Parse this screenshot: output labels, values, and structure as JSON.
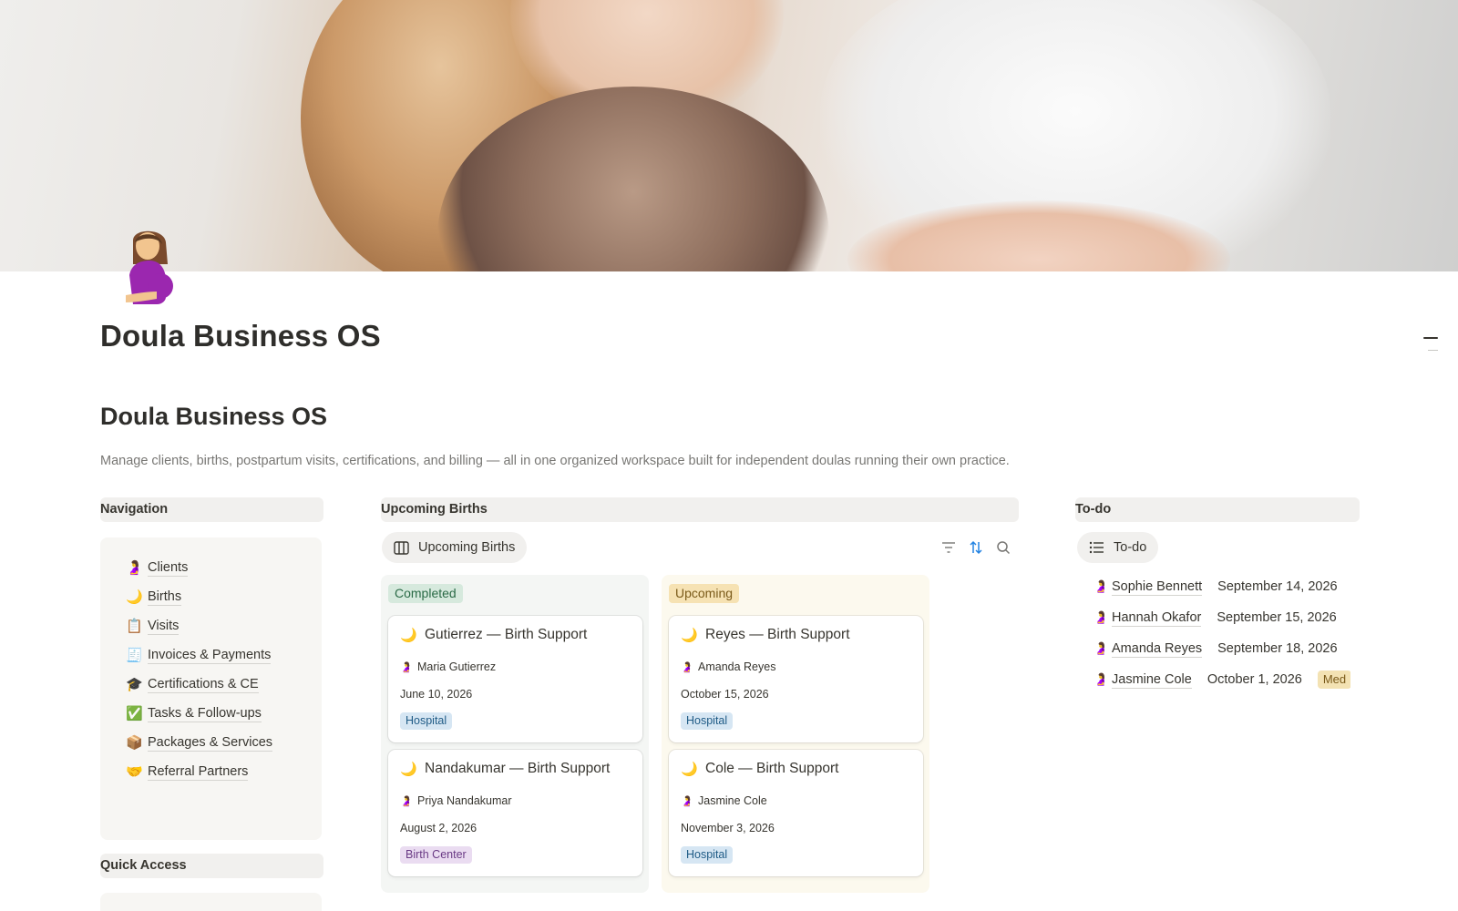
{
  "page": {
    "icon": "pregnant-woman-icon",
    "title": "Doula Business OS",
    "section_title": "Doula Business OS",
    "description": "Manage clients, births, postpartum visits, certifications, and billing — all in one organized workspace built for independent doulas running their own practice."
  },
  "navigation": {
    "header": "Navigation",
    "items": [
      {
        "emoji": "🤰",
        "icon": "pregnant-woman-icon",
        "label": "Clients"
      },
      {
        "emoji": "🌙",
        "icon": "crescent-moon-icon",
        "label": "Births"
      },
      {
        "emoji": "📋",
        "icon": "clipboard-icon",
        "label": "Visits"
      },
      {
        "emoji": "🧾",
        "icon": "receipt-icon",
        "label": "Invoices & Payments"
      },
      {
        "emoji": "🎓",
        "icon": "graduation-cap-icon",
        "label": "Certifications & CE"
      },
      {
        "emoji": "✅",
        "icon": "check-mark-icon",
        "label": "Tasks & Follow-ups"
      },
      {
        "emoji": "📦",
        "icon": "package-icon",
        "label": "Packages & Services"
      },
      {
        "emoji": "🤝",
        "icon": "handshake-icon",
        "label": "Referral Partners"
      }
    ]
  },
  "quick_access": {
    "header": "Quick Access"
  },
  "upcoming_births": {
    "header": "Upcoming Births",
    "view_tab": "Upcoming Births",
    "toolbar": [
      "filter-icon",
      "sort-icon",
      "search-icon"
    ],
    "columns": [
      {
        "status": "Completed",
        "cards": [
          {
            "emoji": "🌙",
            "title": "Gutierrez — Birth Support",
            "client": "Maria Gutierrez",
            "date": "June 10, 2026",
            "tag": "Hospital",
            "tag_color": "#d6e6f3"
          },
          {
            "emoji": "🌙",
            "title": "Nandakumar — Birth Support",
            "client": "Priya Nandakumar",
            "date": "August 2, 2026",
            "tag": "Birth Center",
            "tag_color": "#eadcf1"
          }
        ]
      },
      {
        "status": "Upcoming",
        "cards": [
          {
            "emoji": "🌙",
            "title": "Reyes — Birth Support",
            "client": "Amanda Reyes",
            "date": "October 15, 2026",
            "tag": "Hospital",
            "tag_color": "#d6e6f3"
          },
          {
            "emoji": "🌙",
            "title": "Cole — Birth Support",
            "client": "Jasmine Cole",
            "date": "November 3, 2026",
            "tag": "Hospital",
            "tag_color": "#d6e6f3"
          }
        ]
      }
    ]
  },
  "todo": {
    "header": "To-do",
    "view_tab": "To-do",
    "rows": [
      {
        "emoji": "🤰",
        "name": "Sophie Bennett",
        "date": "September 14, 2026",
        "tag": ""
      },
      {
        "emoji": "🤰",
        "name": "Hannah Okafor",
        "date": "September 15, 2026",
        "tag": ""
      },
      {
        "emoji": "🤰",
        "name": "Amanda Reyes",
        "date": "September 18, 2026",
        "tag": ""
      },
      {
        "emoji": "🤰",
        "name": "Jasmine Cole",
        "date": "October 1, 2026",
        "tag": "Med"
      }
    ]
  },
  "colors": {
    "text": "#37352f",
    "muted": "#787774",
    "completed_bg": "#d6e9dd",
    "upcoming_bg": "#f6e2b3",
    "hospital_tag": "#d6e6f3",
    "birth_center_tag": "#eadcf1"
  }
}
